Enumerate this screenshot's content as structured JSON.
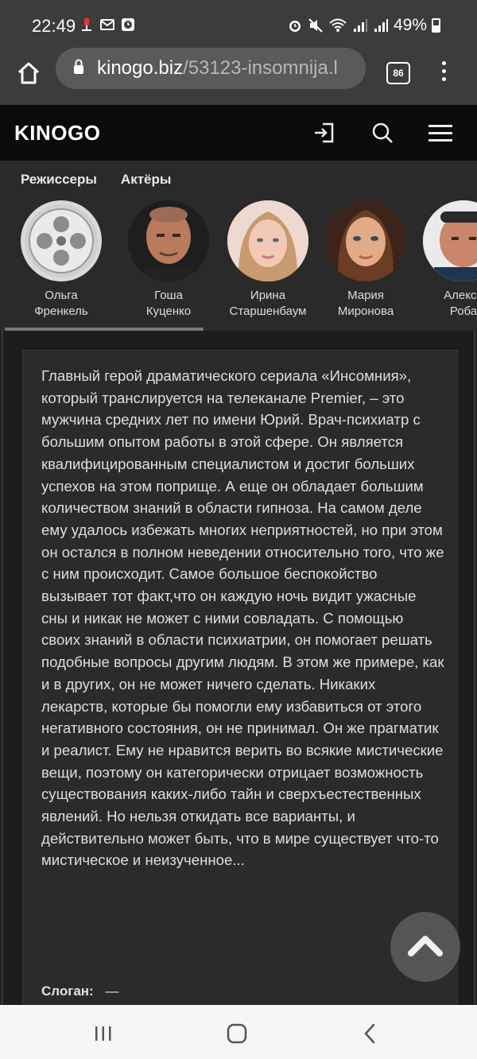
{
  "status_bar": {
    "time": "22:49",
    "battery": "49%"
  },
  "browser": {
    "url_host": "kinogo.biz",
    "url_path": "/53123-insomnija.l",
    "tab_count": "86"
  },
  "site": {
    "logo": "KINOGO"
  },
  "cast": {
    "directors_label": "Режиссеры",
    "actors_label": "Актёры",
    "people": [
      {
        "line1": "Ольга",
        "line2": "Френкель"
      },
      {
        "line1": "Гоша",
        "line2": "Куценко"
      },
      {
        "line1": "Ирина",
        "line2": "Старшенбаум"
      },
      {
        "line1": "Мария",
        "line2": "Миронова"
      },
      {
        "line1": "Алекса",
        "line2": "Роба"
      }
    ]
  },
  "description": "Главный герой драматического сериала «Инсомния», который транслируется на телеканале Premier, – это мужчина средних лет по имени Юрий. Врач-психиатр с большим опытом работы в этой сфере. Он является квалифицированным специалистом и достиг больших успехов на этом поприще. А еще он обладает большим количеством знаний в области гипноза. На самом деле ему удалось избежать многих неприятностей, но при этом он остался в полном неведении относительно того, что же с ним происходит. Самое большое беспокойство вызывает тот факт,что он каждую ночь видит ужасные сны и никак не может с ними совладать. С помощью своих знаний в области психиатрии, он помогает решать подобные вопросы другим людям. В этом же примере, как и в других, он не может ничего сделать. Никаких лекарств, которые бы помогли ему избавиться от этого негативного состояния, он не принимал. Он же прагматик и реалист. Ему не нравится верить во всякие мистические вещи, поэтому он категорически отрицает возможность существования каких-либо тайн и сверхъестественных явлений. Но нельзя откидать все варианты, и действительно может быть, что в мире существует что-то мистическое и неизученное...",
  "slogan": {
    "label": "Слоган:",
    "value": "—"
  }
}
